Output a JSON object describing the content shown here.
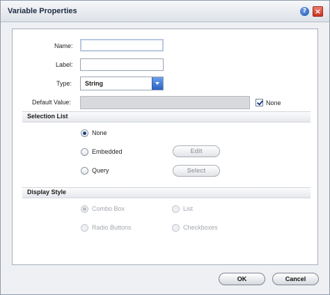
{
  "window": {
    "title": "Variable Properties",
    "help_glyph": "?",
    "close_glyph": "×"
  },
  "form": {
    "name_label": "Name:",
    "name_value": "",
    "label_label": "Label:",
    "label_value": "",
    "type_label": "Type:",
    "type_value": "String",
    "default_label": "Default Value:",
    "default_value": "",
    "none_label": "None",
    "none_checked": true
  },
  "selection_list": {
    "title": "Selection List",
    "options": [
      {
        "label": "None",
        "checked": true
      },
      {
        "label": "Embedded",
        "checked": false
      },
      {
        "label": "Query",
        "checked": false
      }
    ],
    "edit_button": "Edit",
    "select_button": "Select"
  },
  "display_style": {
    "title": "Display Style",
    "options": [
      {
        "label": "Combo Box",
        "checked": true,
        "enabled": false
      },
      {
        "label": "List",
        "checked": false,
        "enabled": false
      },
      {
        "label": "Radio Buttons",
        "checked": false,
        "enabled": false
      },
      {
        "label": "Checkboxes",
        "checked": false,
        "enabled": false
      }
    ]
  },
  "footer": {
    "ok_label": "OK",
    "cancel_label": "Cancel"
  },
  "icons": [
    "help-icon",
    "close-icon",
    "dropdown-arrow-icon",
    "checkmark-icon"
  ],
  "colors": {
    "accent": "#2a62c2",
    "close": "#c8341f",
    "disabled_text": "#a3a7ad"
  }
}
